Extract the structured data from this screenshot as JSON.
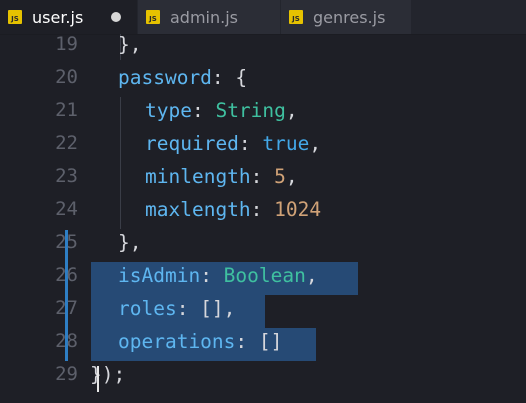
{
  "tabs": [
    {
      "label": "user.js",
      "icon": "js-file-icon",
      "badge": "JS",
      "active": true,
      "unsaved": true
    },
    {
      "label": "admin.js",
      "icon": "js-file-icon",
      "badge": "JS",
      "active": false,
      "unsaved": false
    },
    {
      "label": "genres.js",
      "icon": "js-file-icon",
      "badge": "JS",
      "active": false,
      "unsaved": false
    }
  ],
  "line_numbers": [
    "19",
    "20",
    "21",
    "22",
    "23",
    "24",
    "25",
    "26",
    "27",
    "28",
    "29"
  ],
  "code": {
    "l19": "},",
    "l20_key": "password",
    "l20_rest": ": {",
    "l21_key": "type",
    "l21_val": "String",
    "l22_key": "required",
    "l22_val": "true",
    "l23_key": "minlength",
    "l23_val": "5",
    "l24_key": "maxlength",
    "l24_val": "1024",
    "l25": "},",
    "l26_key": "isAdmin",
    "l26_val": "Boolean",
    "l27_key": "roles",
    "l27_rest": ": [],",
    "l28_key": "operations",
    "l28_rest": ": []",
    "l29": "});"
  },
  "colors": {
    "background": "#1e1f26",
    "keyword": "#5eb6f0",
    "type": "#3fc0a0",
    "constant": "#43a8e8",
    "number": "#d0a277",
    "selection": "#264a75",
    "js_badge": "#e6c200"
  }
}
